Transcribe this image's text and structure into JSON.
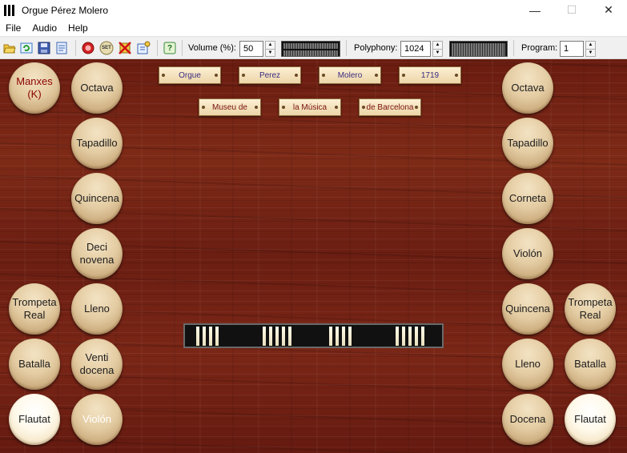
{
  "window": {
    "title": "Orgue Pérez Molero",
    "minimize_glyph": "—",
    "maximize_glyph": "☐",
    "close_glyph": "✕"
  },
  "menu": [
    "File",
    "Audio",
    "Help"
  ],
  "toolbar": {
    "icons": [
      "open-icon",
      "refresh-icon",
      "save-icon",
      "properties-icon",
      "record-icon",
      "set-icon",
      "panic-icon",
      "settings-icon",
      "help-icon"
    ],
    "set_icon_text": "SET",
    "help_icon_glyph": "?",
    "volume_label": "Volume (%):",
    "volume_value": "50",
    "polyphony_label": "Polyphony:",
    "polyphony_value": "1024",
    "program_label": "Program:",
    "program_value": "1",
    "spin_up": "▲",
    "spin_down": "▼"
  },
  "plates": {
    "row1": [
      "Orgue",
      "Perez",
      "Molero",
      "1719"
    ],
    "row2": [
      "Museu de",
      "la Música",
      "de Barcelona"
    ]
  },
  "left_outer_stops": [
    {
      "label": "Manxes\n(K)",
      "state": "off",
      "color": "#8b0000"
    },
    {
      "label": "Trompeta\nReal",
      "state": "off"
    },
    {
      "label": "Batalla",
      "state": "off"
    },
    {
      "label": "Flautat",
      "state": "on"
    }
  ],
  "left_inner_stops": [
    {
      "label": "Octava",
      "state": "off"
    },
    {
      "label": "Tapadillo",
      "state": "off"
    },
    {
      "label": "Quincena",
      "state": "off"
    },
    {
      "label": "Deci\nnovena",
      "state": "off"
    },
    {
      "label": "Lleno",
      "state": "off"
    },
    {
      "label": "Venti\ndocena",
      "state": "off"
    },
    {
      "label": "Violón",
      "state": "off",
      "color": "#ffffff"
    }
  ],
  "right_inner_stops": [
    {
      "label": "Octava",
      "state": "off"
    },
    {
      "label": "Tapadillo",
      "state": "off"
    },
    {
      "label": "Corneta",
      "state": "off"
    },
    {
      "label": "Violón",
      "state": "off"
    },
    {
      "label": "Quincena",
      "state": "off"
    },
    {
      "label": "Lleno",
      "state": "off"
    },
    {
      "label": "Docena",
      "state": "off"
    }
  ],
  "right_outer_stops": [
    {
      "label": "Trompeta\nReal",
      "state": "off"
    },
    {
      "label": "Batalla",
      "state": "off"
    },
    {
      "label": "Flautat",
      "state": "on"
    }
  ]
}
